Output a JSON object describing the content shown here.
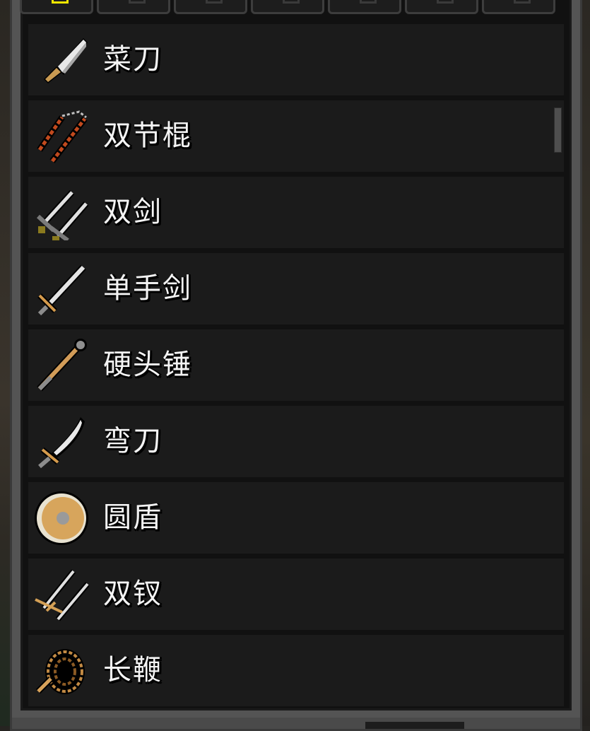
{
  "tabs": [
    {
      "name": "tab-weapons",
      "active": true
    },
    {
      "name": "tab-2",
      "active": false
    },
    {
      "name": "tab-3",
      "active": false
    },
    {
      "name": "tab-4",
      "active": false
    },
    {
      "name": "tab-5",
      "active": false
    },
    {
      "name": "tab-6",
      "active": false
    },
    {
      "name": "tab-7",
      "active": false
    }
  ],
  "items": [
    {
      "label": "菜刀",
      "icon": "cleaver-icon"
    },
    {
      "label": "双节棍",
      "icon": "nunchaku-icon"
    },
    {
      "label": "双剑",
      "icon": "twin-swords-icon"
    },
    {
      "label": "单手剑",
      "icon": "one-handed-sword-icon"
    },
    {
      "label": "硬头锤",
      "icon": "mace-icon"
    },
    {
      "label": "弯刀",
      "icon": "scimitar-icon"
    },
    {
      "label": "圆盾",
      "icon": "round-shield-icon"
    },
    {
      "label": "双钗",
      "icon": "twin-sai-icon"
    },
    {
      "label": "长鞭",
      "icon": "whip-icon"
    }
  ],
  "colors": {
    "panel": "#545454",
    "row": "#1b1b1b",
    "active_tab": "#f2e600",
    "text": "#f4f4f4"
  }
}
